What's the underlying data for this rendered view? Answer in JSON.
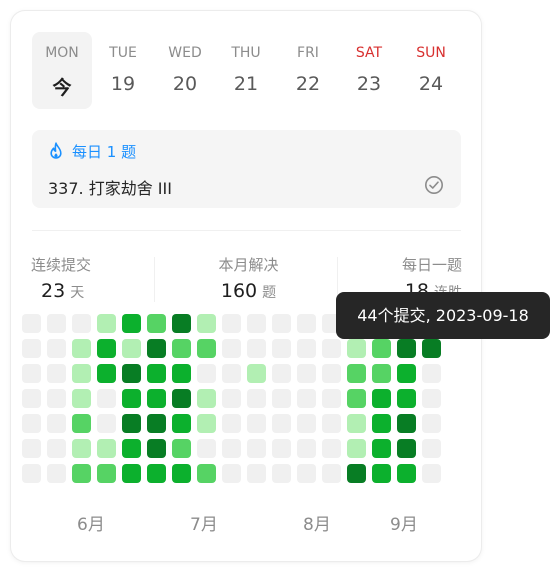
{
  "week": [
    {
      "name": "MON",
      "num": "今",
      "today": true,
      "weekend": false
    },
    {
      "name": "TUE",
      "num": "19",
      "today": false,
      "weekend": false
    },
    {
      "name": "WED",
      "num": "20",
      "today": false,
      "weekend": false
    },
    {
      "name": "THU",
      "num": "21",
      "today": false,
      "weekend": false
    },
    {
      "name": "FRI",
      "num": "22",
      "today": false,
      "weekend": false
    },
    {
      "name": "SAT",
      "num": "23",
      "today": false,
      "weekend": true
    },
    {
      "name": "SUN",
      "num": "24",
      "today": false,
      "weekend": true
    }
  ],
  "daily": {
    "header": "每日 1 题",
    "question": "337. 打家劫舍 III",
    "icon": "flame-icon",
    "status_icon": "check-circle-icon"
  },
  "stats": {
    "streak": {
      "label": "连续提交",
      "value": "23",
      "unit": "天"
    },
    "month_solved": {
      "label": "本月解决",
      "value": "160",
      "unit": "题"
    },
    "daily_streak": {
      "label": "每日一题",
      "value": "18",
      "unit": "连胜"
    }
  },
  "heatmap": {
    "colors": [
      "#f0f0f0",
      "#b2efb3",
      "#56d364",
      "#0cb02d",
      "#087d24"
    ],
    "levels": [
      [
        0,
        0,
        0,
        1,
        3,
        2,
        4,
        1,
        0,
        0,
        0,
        0,
        0,
        0,
        0,
        0,
        0
      ],
      [
        0,
        0,
        1,
        3,
        1,
        4,
        2,
        2,
        0,
        0,
        0,
        0,
        0,
        1,
        2,
        4,
        4
      ],
      [
        0,
        0,
        1,
        3,
        4,
        3,
        3,
        0,
        0,
        1,
        0,
        0,
        0,
        2,
        2,
        3,
        0
      ],
      [
        0,
        0,
        1,
        0,
        3,
        3,
        4,
        1,
        0,
        0,
        0,
        0,
        0,
        2,
        3,
        3,
        0
      ],
      [
        0,
        0,
        2,
        0,
        4,
        4,
        3,
        1,
        0,
        0,
        0,
        0,
        0,
        1,
        3,
        4,
        0
      ],
      [
        0,
        0,
        1,
        1,
        3,
        4,
        2,
        0,
        0,
        0,
        0,
        0,
        0,
        1,
        3,
        4,
        0
      ],
      [
        0,
        0,
        2,
        2,
        3,
        3,
        3,
        2,
        0,
        0,
        0,
        0,
        0,
        4,
        3,
        3,
        0
      ]
    ],
    "months": [
      "6月",
      "7月",
      "8月",
      "9月"
    ]
  },
  "tooltip": {
    "text": "44个提交, 2023-09-18"
  }
}
